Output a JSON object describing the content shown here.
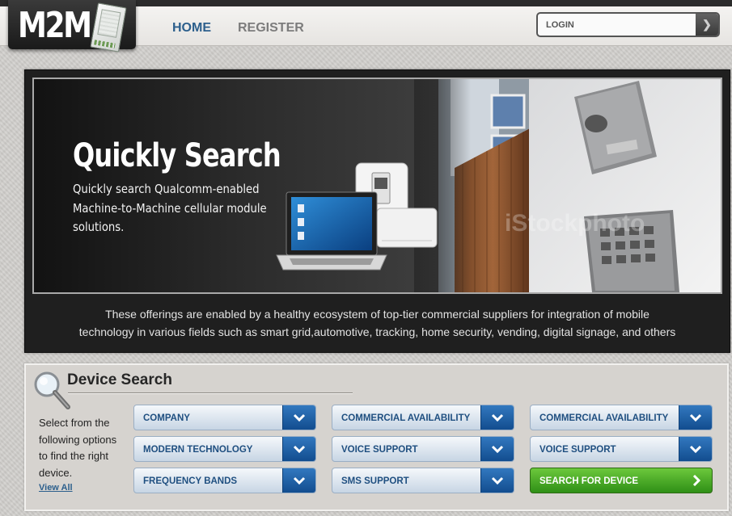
{
  "header": {
    "logo": {
      "text": "M2M",
      "icon": "m2m-module-icon"
    },
    "nav": [
      {
        "label": "HOME",
        "active": true
      },
      {
        "label": "REGISTER",
        "active": false
      }
    ],
    "login": {
      "placeholder": "LOGIN",
      "value": "",
      "button_icon": "chevron-right-icon"
    }
  },
  "hero": {
    "title": "Quickly Search",
    "text": "Quickly search Qualcomm-enabled Machine-to-Machine cellular module solutions.",
    "watermark": "iStockphoto",
    "caption_line1": "These offerings are enabled by a healthy ecosystem of top-tier commercial suppliers for integration of mobile",
    "caption_line2": "technology in various fields such as smart grid,automotive, tracking, home security, vending, digital signage, and others"
  },
  "device_search": {
    "title": "Device Search",
    "icon": "magnifier-icon",
    "description": "Select from the following options to find the right device.",
    "view_all": "View All",
    "filters": [
      {
        "label": "COMPANY"
      },
      {
        "label": "MODERN TECHNOLOGY"
      },
      {
        "label": "FREQUENCY BANDS"
      },
      {
        "label": "COMMERCIAL AVAILABILITY"
      },
      {
        "label": "VOICE SUPPORT"
      },
      {
        "label": "SMS SUPPORT"
      },
      {
        "label": "COMMERCIAL AVAILABILITY"
      },
      {
        "label": "VOICE SUPPORT"
      }
    ],
    "search_button": "SEARCH FOR DEVICE"
  },
  "colors": {
    "nav_active": "#2c5f8c",
    "nav_inactive": "#7c7c7c",
    "select_label": "#1f4f80",
    "select_arrow": "#1d5fa6",
    "search_button": "#3f9f22"
  }
}
